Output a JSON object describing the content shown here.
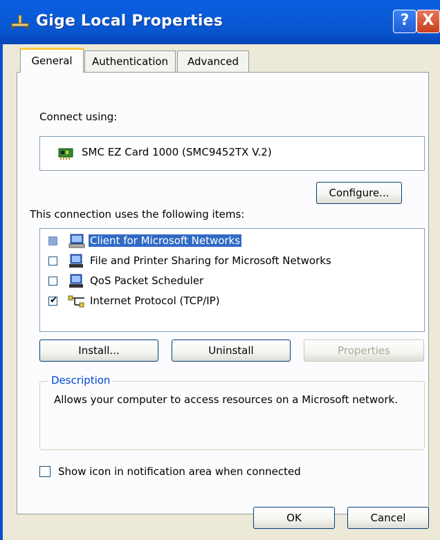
{
  "window": {
    "title": "Gige Local Properties",
    "help_glyph": "?",
    "close_glyph": "X"
  },
  "tabs": [
    {
      "label": "General",
      "active": true
    },
    {
      "label": "Authentication",
      "active": false
    },
    {
      "label": "Advanced",
      "active": false
    }
  ],
  "general": {
    "connect_using_label": "Connect using:",
    "adapter_name": "SMC EZ Card 1000 (SMC9452TX V.2)",
    "configure_button": "Configure...",
    "items_label": "This connection uses the following items:",
    "items": [
      {
        "label": "Client for Microsoft Networks",
        "checked": false,
        "selected": true,
        "icon": "network-client-icon"
      },
      {
        "label": "File and Printer Sharing for Microsoft Networks",
        "checked": false,
        "selected": false,
        "icon": "network-service-icon"
      },
      {
        "label": "QoS Packet Scheduler",
        "checked": false,
        "selected": false,
        "icon": "network-service-icon"
      },
      {
        "label": "Internet Protocol (TCP/IP)",
        "checked": true,
        "selected": false,
        "icon": "network-protocol-icon"
      }
    ],
    "install_button": "Install...",
    "uninstall_button": "Uninstall",
    "properties_button": "Properties",
    "description_legend": "Description",
    "description_text": "Allows your computer to access resources on a Microsoft network.",
    "show_icon_label": "Show icon in notification area when connected",
    "show_icon_checked": false
  },
  "footer": {
    "ok_button": "OK",
    "cancel_button": "Cancel"
  },
  "colors": {
    "titlebar": "#0a5bd8",
    "selection": "#316ac5",
    "group_legend": "#0046d5"
  }
}
